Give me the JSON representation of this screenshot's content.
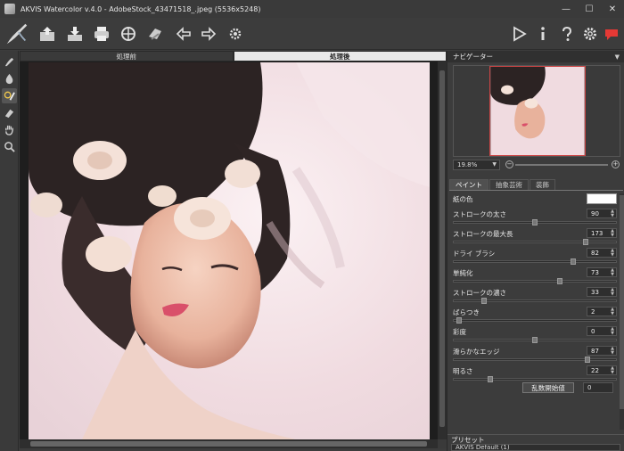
{
  "window": {
    "title": "AKVIS Watercolor v.4.0 - AdobeStock_43471518_.jpeg (5536x5248)",
    "minimize": "—",
    "maximize": "☐",
    "close": "✕"
  },
  "canvas_tabs": {
    "before": "処理前",
    "after": "処理後"
  },
  "navigator": {
    "title": "ナビゲーター",
    "zoom": "19.8%"
  },
  "panel_tabs": [
    "ペイント",
    "抽象芸術",
    "装飾"
  ],
  "params": {
    "paper_color_label": "紙の色",
    "stroke_thickness": {
      "label": "ストロークの太さ",
      "value": "90",
      "fraction": 0.5
    },
    "max_stroke_length": {
      "label": "ストロークの最大長",
      "value": "173",
      "fraction": 0.82
    },
    "dry_brush": {
      "label": "ドライ ブラシ",
      "value": "82",
      "fraction": 0.74
    },
    "simplification": {
      "label": "単純化",
      "value": "73",
      "fraction": 0.66
    },
    "stroke_density": {
      "label": "ストロークの濃さ",
      "value": "33",
      "fraction": 0.18
    },
    "roughness": {
      "label": "ばらつき",
      "value": "2",
      "fraction": 0.02
    },
    "saturation": {
      "label": "彩度",
      "value": "0",
      "fraction": 0.5
    },
    "smooth_edges": {
      "label": "滑らかなエッジ",
      "value": "87",
      "fraction": 0.83
    },
    "brightness": {
      "label": "明るさ",
      "value": "22",
      "fraction": 0.22
    }
  },
  "seed": {
    "label": "乱数開始値",
    "value": "0"
  },
  "preset": {
    "title": "プリセット",
    "selected": "AKVIS Default (1)"
  },
  "colors": {
    "accent_record": "#e53935",
    "panel_bg": "#3c3c3c"
  },
  "toolbar_icons": [
    "brush-logo-icon",
    "open-icon",
    "save-icon",
    "print-icon",
    "share-icon",
    "batch-icon",
    "undo-icon",
    "redo-icon",
    "plugins-icon",
    "run-icon",
    "info-icon",
    "help-icon",
    "settings-icon",
    "feedback-icon"
  ],
  "tool_icons": [
    "watercolor-brush-icon",
    "drop-icon",
    "history-brush-icon",
    "eraser-icon",
    "hand-icon",
    "zoom-icon"
  ]
}
